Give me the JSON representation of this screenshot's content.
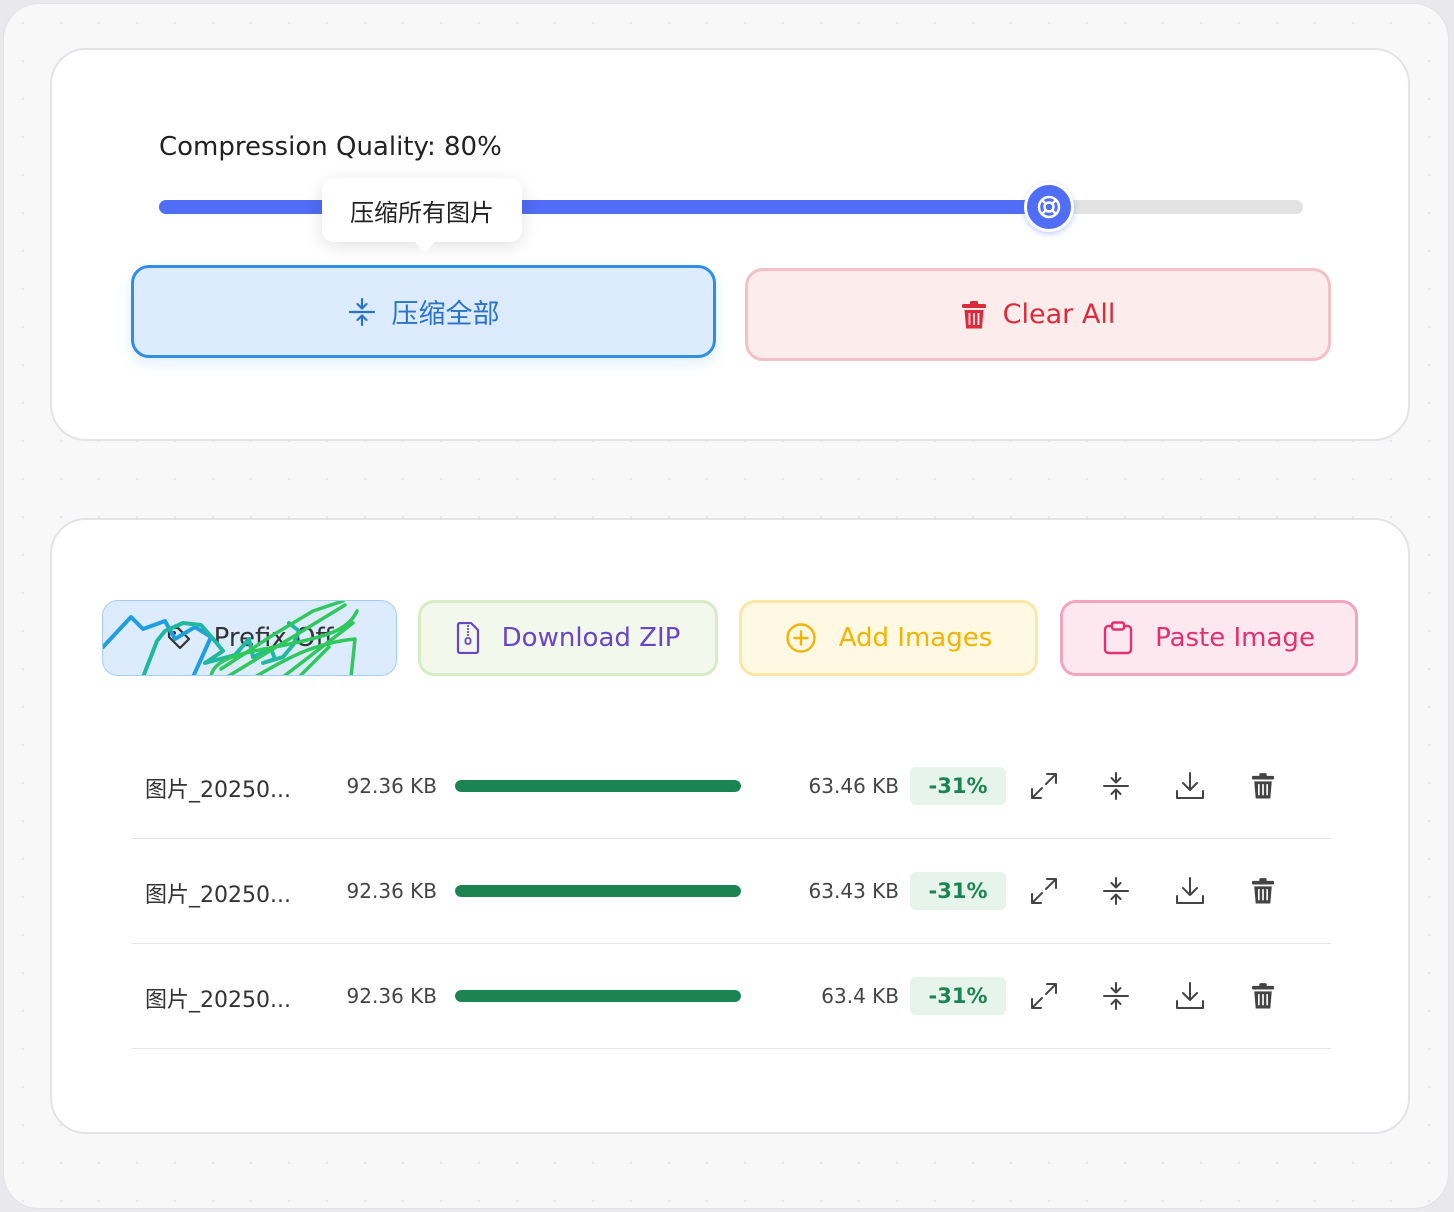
{
  "quality": {
    "label": "Compression Quality: 80%",
    "value": 80
  },
  "tooltip": {
    "text": "压缩所有图片"
  },
  "buttons": {
    "compress_all": "压缩全部",
    "clear_all": "Clear All"
  },
  "actions": {
    "prefix": "Prefix Off",
    "download_zip": "Download ZIP",
    "add_images": "Add Images",
    "paste_image": "Paste Image"
  },
  "files": [
    {
      "name": "图片_20250...",
      "original_size": "92.36 KB",
      "compressed_size": "63.46 KB",
      "reduction": "-31%",
      "progress": 1.0
    },
    {
      "name": "图片_20250...",
      "original_size": "92.36 KB",
      "compressed_size": "63.43 KB",
      "reduction": "-31%",
      "progress": 1.0
    },
    {
      "name": "图片_20250...",
      "original_size": "92.36 KB",
      "compressed_size": "63.4 KB",
      "reduction": "-31%",
      "progress": 1.0
    }
  ],
  "colors": {
    "accent": "#4f6df5",
    "compress": "#2a73c8",
    "clear": "#dc2a3a",
    "zip": "#6b45c8",
    "add": "#f3b400",
    "paste": "#e42f72",
    "success": "#1b8451"
  },
  "icons": {
    "compress": "compress-icon",
    "trash": "trash-icon",
    "prefix": "tag-icon",
    "zip": "zip-file-icon",
    "add": "plus-circle-icon",
    "paste": "clipboard-icon",
    "preview": "expand-icon",
    "recompress": "compress-icon",
    "download": "download-icon",
    "delete": "trash-icon"
  }
}
